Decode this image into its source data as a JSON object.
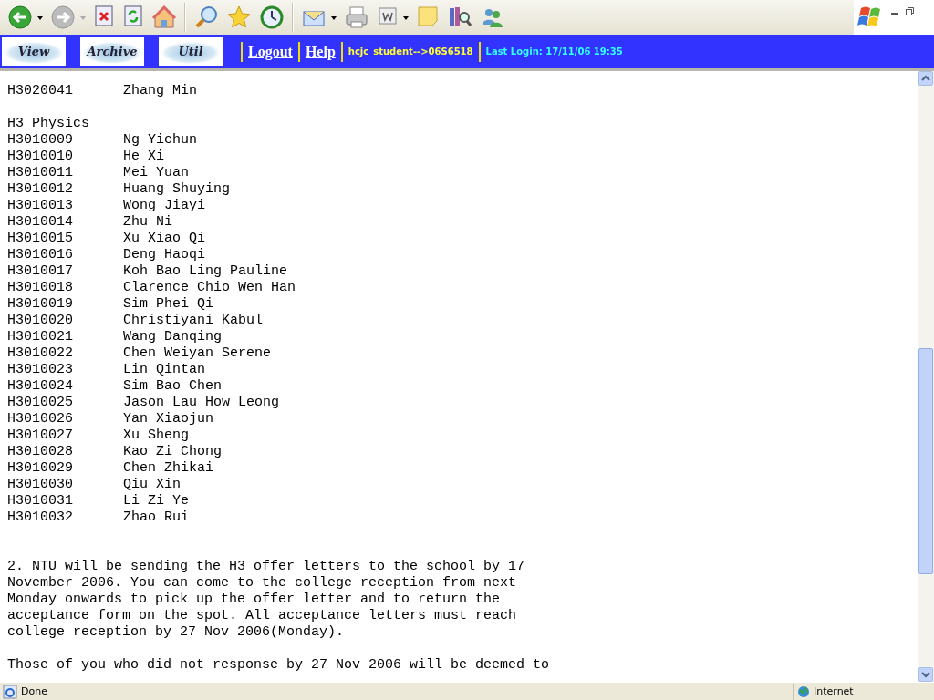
{
  "site_nav": {
    "logo_buttons": [
      "View",
      "Archive",
      "Util"
    ],
    "links": [
      "Logout",
      "Help"
    ],
    "user": "hcjc_student-->06S6518",
    "last_login": "Last Login: 17/11/06 19:35"
  },
  "content": {
    "groups": [
      {
        "students": [
          {
            "id": "H3020041",
            "name": "Zhang Min"
          }
        ]
      },
      {
        "heading": "H3 Physics",
        "students": [
          {
            "id": "H3010009",
            "name": "Ng Yichun"
          },
          {
            "id": "H3010010",
            "name": "He Xi"
          },
          {
            "id": "H3010011",
            "name": "Mei Yuan"
          },
          {
            "id": "H3010012",
            "name": "Huang Shuying"
          },
          {
            "id": "H3010013",
            "name": "Wong Jiayi"
          },
          {
            "id": "H3010014",
            "name": "Zhu Ni"
          },
          {
            "id": "H3010015",
            "name": "Xu Xiao Qi"
          },
          {
            "id": "H3010016",
            "name": "Deng Haoqi"
          },
          {
            "id": "H3010017",
            "name": "Koh Bao Ling Pauline"
          },
          {
            "id": "H3010018",
            "name": "Clarence Chio Wen Han"
          },
          {
            "id": "H3010019",
            "name": "Sim Phei Qi"
          },
          {
            "id": "H3010020",
            "name": "Christiyani Kabul"
          },
          {
            "id": "H3010021",
            "name": "Wang Danqing"
          },
          {
            "id": "H3010022",
            "name": "Chen Weiyan Serene"
          },
          {
            "id": "H3010023",
            "name": "Lin Qintan"
          },
          {
            "id": "H3010024",
            "name": "Sim Bao Chen"
          },
          {
            "id": "H3010025",
            "name": "Jason Lau How Leong"
          },
          {
            "id": "H3010026",
            "name": "Yan Xiaojun"
          },
          {
            "id": "H3010027",
            "name": "Xu Sheng"
          },
          {
            "id": "H3010028",
            "name": "Kao Zi Chong"
          },
          {
            "id": "H3010029",
            "name": "Chen Zhikai"
          },
          {
            "id": "H3010030",
            "name": "Qiu Xin"
          },
          {
            "id": "H3010031",
            "name": "Li Zi Ye"
          },
          {
            "id": "H3010032",
            "name": "Zhao Rui"
          }
        ]
      }
    ],
    "paragraphs": [
      "2. NTU will be sending the H3 offer letters to the school by 17\nNovember 2006. You can come to the college reception from next\nMonday onwards to pick up the offer letter and to return the\nacceptance form on the spot. All acceptance letters must reach\ncollege reception by 27 Nov 2006(Monday).",
      "Those of you who did not response by 27 Nov 2006 will be deemed to"
    ]
  },
  "status_bar": {
    "text": "Done",
    "zone": "Internet"
  }
}
